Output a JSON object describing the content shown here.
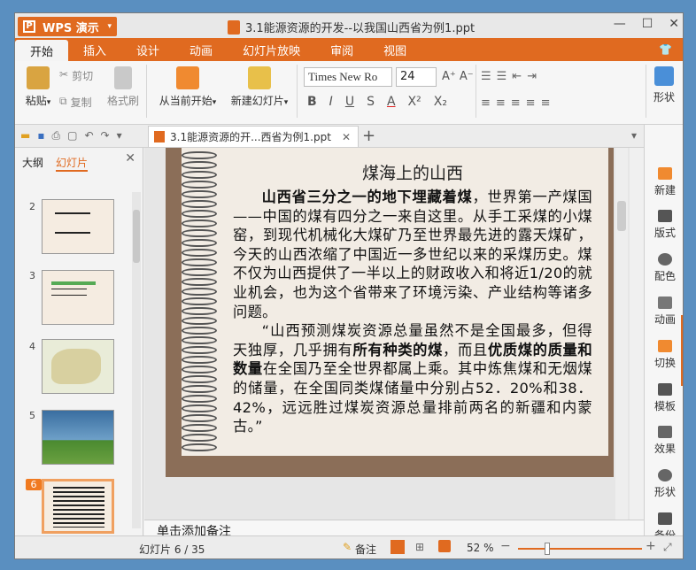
{
  "app": {
    "name": "WPS 演示",
    "doc_title": "3.1能源资源的开发--以我国山西省为例1.ppt"
  },
  "tabs": [
    "开始",
    "插入",
    "设计",
    "动画",
    "幻灯片放映",
    "审阅",
    "视图"
  ],
  "ribbon": {
    "paste": "粘贴",
    "cut": "剪切",
    "copy": "复制",
    "format_painter": "格式刷",
    "from_current": "从当前开始",
    "new_slide": "新建幻灯片",
    "font_name": "Times New Ro",
    "font_size": "24",
    "shape": "形状"
  },
  "doc_tab": "3.1能源资源的开...西省为例1.ppt",
  "left_panel": {
    "tab_outline": "大纲",
    "tab_slides": "幻灯片",
    "slide_numbers": [
      "2",
      "3",
      "4",
      "5",
      "6"
    ]
  },
  "slide": {
    "title": "煤海上的山西",
    "p1_bold": "山西省三分之一的地下埋藏着煤",
    "p1_rest": "，世界第一产煤国——中国的煤有四分之一来自这里。从手工采煤的小煤窑，到现代机械化大煤矿乃至世界最先进的露天煤矿，今天的山西浓缩了中国近一多世纪以来的采煤历史。煤不仅为山西提供了一半以上的财政收入和将近1/20的就业机会，也为这个省带来了环境污染、产业结构等诸多问题。",
    "p2_a": "“山西预测煤炭资源总量虽然不是全国最多，但得天独厚，几乎拥有",
    "p2_b": "所有种类的煤",
    "p2_c": "，而且",
    "p2_d": "优质煤的质量和数量",
    "p2_e": "在全国乃至全世界都属上乘。其中炼焦煤和无烟煤的储量，在全国同类煤储量中分别占52．20%和38．42%，远远胜过煤炭资源总量排前两名的新疆和内蒙古。”"
  },
  "notes_placeholder": "单击添加备注",
  "right_sidebar": [
    "新建",
    "版式",
    "配色",
    "动画",
    "切换",
    "模板",
    "效果",
    "形状",
    "备份"
  ],
  "status": {
    "slide_info": "幻灯片 6 / 35",
    "notes": "备注",
    "zoom": "52 %"
  }
}
